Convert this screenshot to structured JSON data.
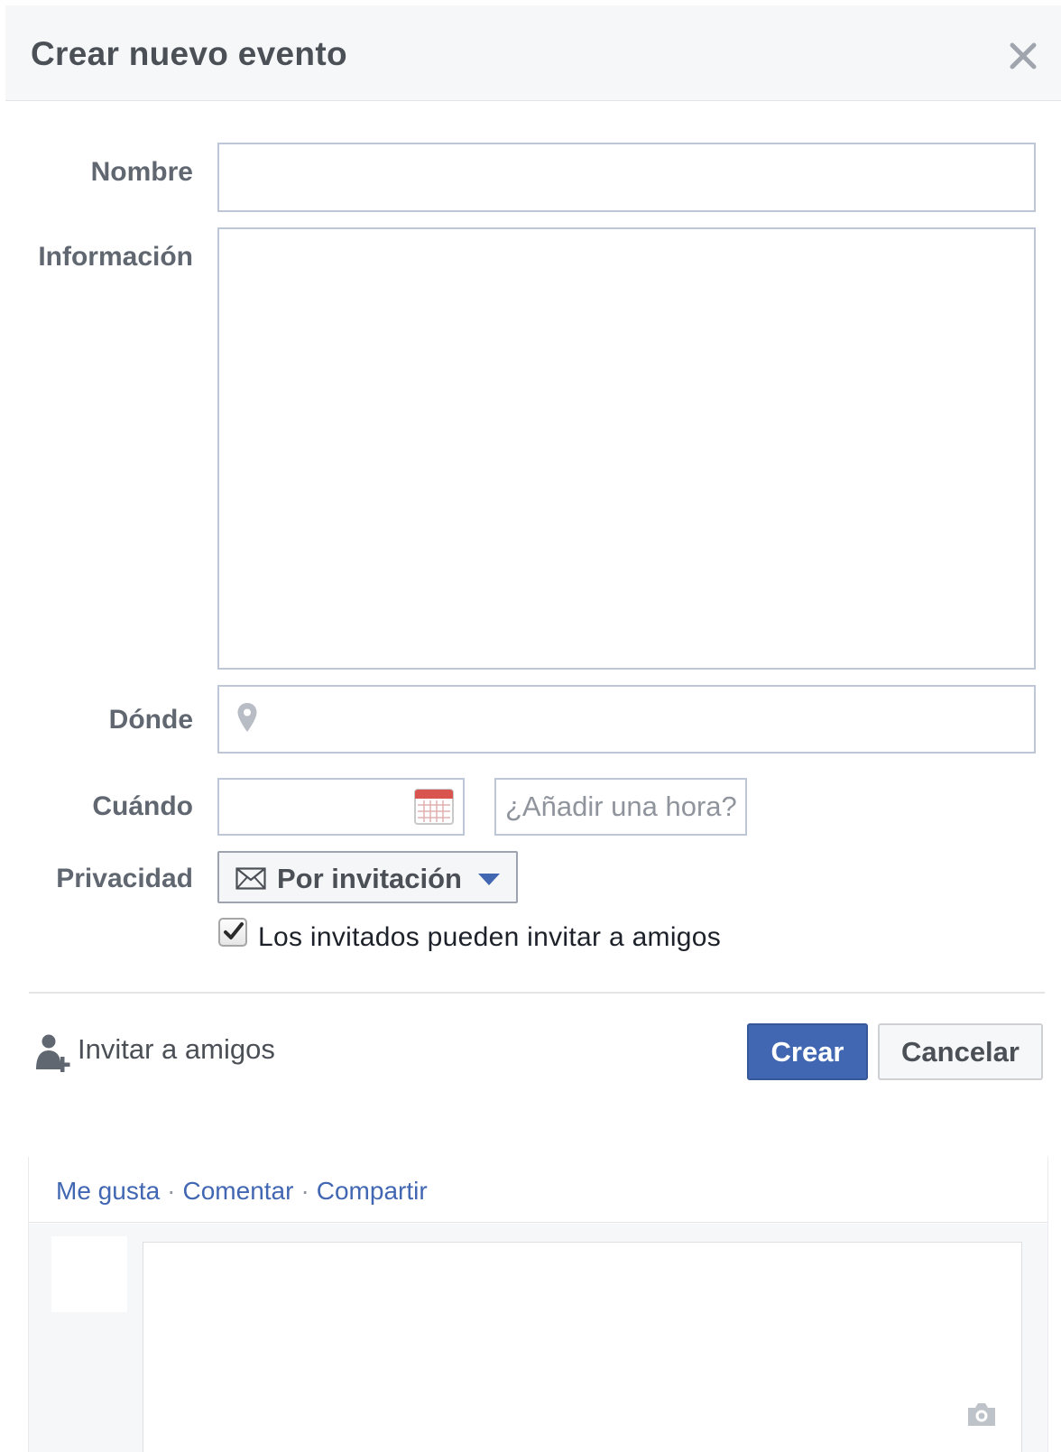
{
  "dialog": {
    "title": "Crear nuevo evento",
    "close_icon": "close-icon"
  },
  "form": {
    "name_label": "Nombre",
    "name_value": "",
    "info_label": "Información",
    "info_value": "",
    "where_label": "Dónde",
    "where_value": "",
    "where_icon": "map-pin-icon",
    "when_label": "Cuándo",
    "date_value": "",
    "date_icon": "calendar-icon",
    "time_placeholder": "¿Añadir una hora?",
    "privacy_label": "Privacidad",
    "privacy_value": "Por invitación",
    "privacy_icon": "envelope-icon",
    "guests_can_invite_checked": true,
    "guests_can_invite_label": "Los invitados pueden invitar a amigos"
  },
  "footer": {
    "invite_label": "Invitar a amigos",
    "invite_icon": "add-friend-icon",
    "create_label": "Crear",
    "cancel_label": "Cancelar"
  },
  "comments": {
    "like_label": "Me gusta",
    "comment_label": "Comentar",
    "share_label": "Compartir",
    "separator": "·",
    "comment_value": "",
    "camera_icon": "camera-icon"
  },
  "colors": {
    "primary_button": "#4267b2",
    "link": "#4267b2",
    "header_bg": "#f6f7f9",
    "field_border": "#bdc7d8",
    "calendar_accent": "#d9534f"
  }
}
